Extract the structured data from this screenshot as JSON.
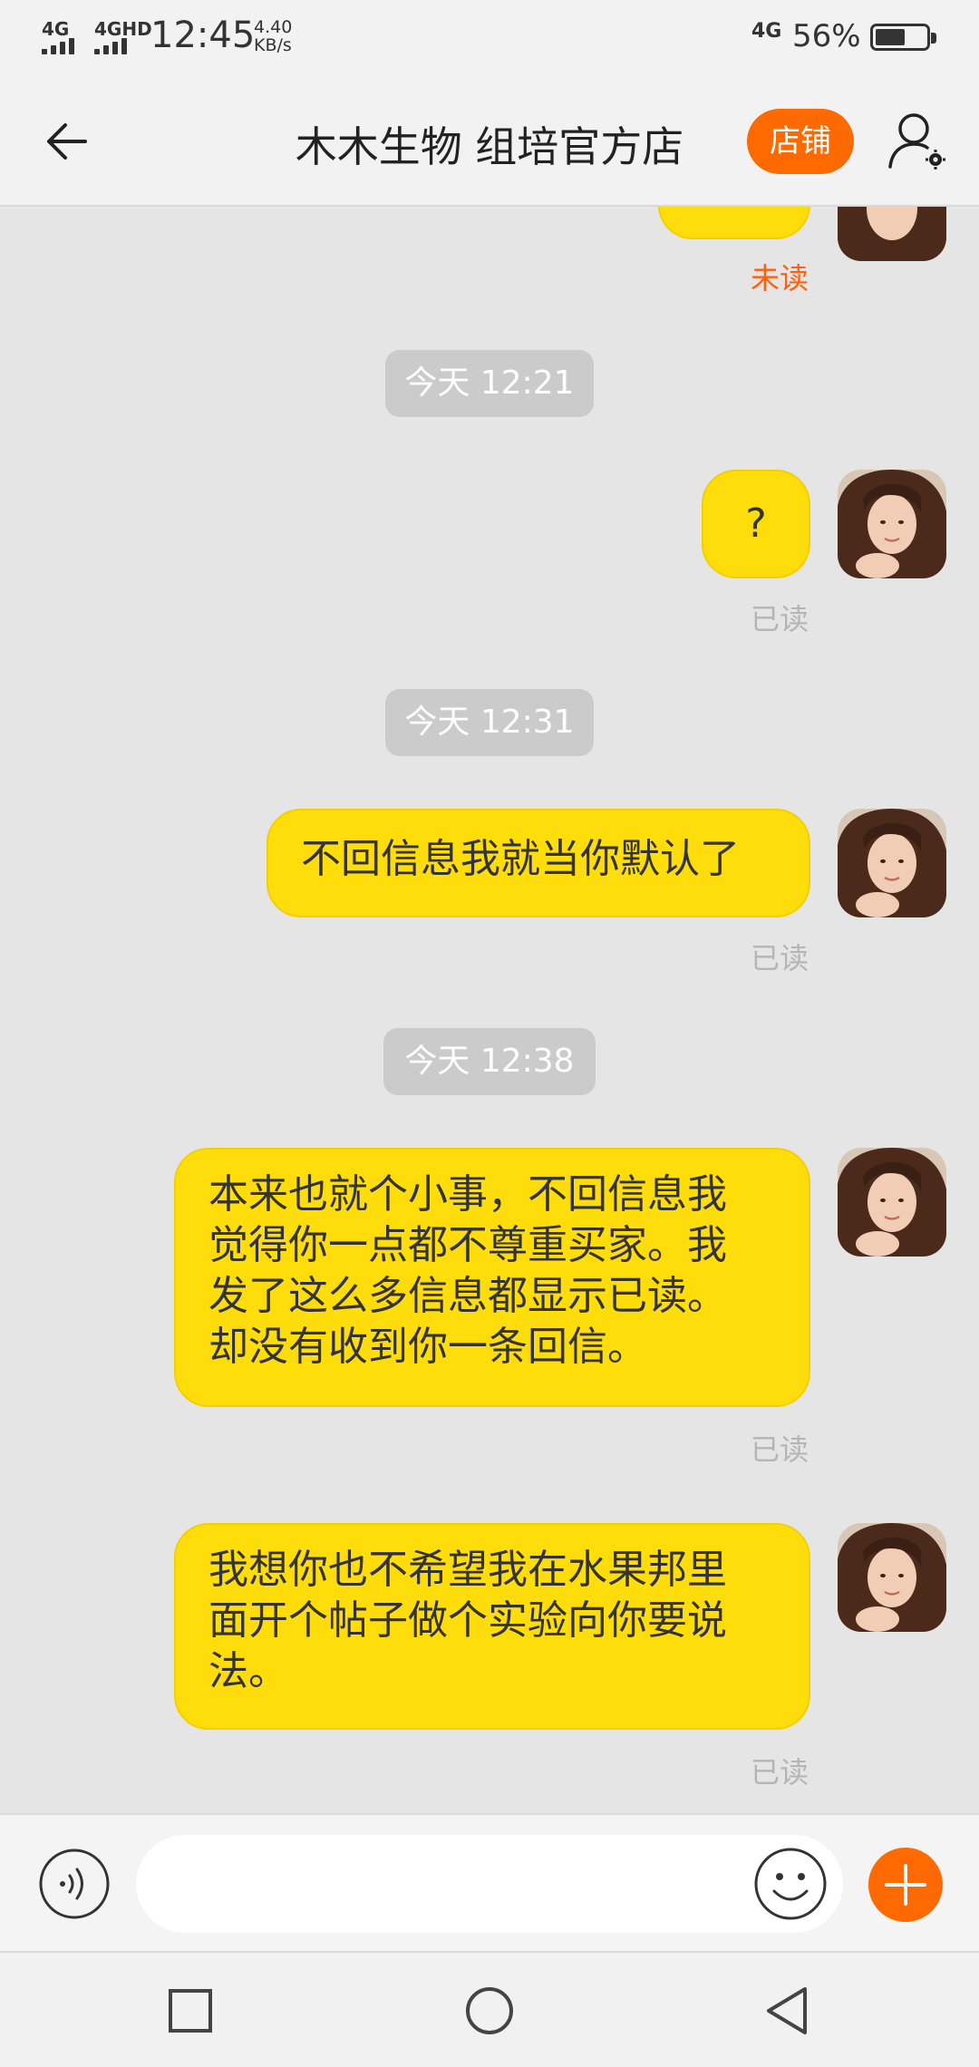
{
  "status_bar": {
    "signal1": "4G",
    "signal2": "4GHD",
    "time": "12:45",
    "speed_value": "4.40",
    "speed_unit": "KB/s",
    "network": "4G",
    "battery": "56%"
  },
  "header": {
    "title": "木木生物 组培官方店",
    "shop_label": "店铺"
  },
  "messages": {
    "m0_status": "未读",
    "ts1": "今天  12:21",
    "m1_text": "?",
    "m1_status": "已读",
    "ts2": "今天  12:31",
    "m2_text": "不回信息我就当你默认了",
    "m2_status": "已读",
    "ts3": "今天  12:38",
    "m3_lines": [
      "本来也就个小事，不回信息我",
      "觉得你一点都不尊重买家。我",
      "发了这么多信息都显示已读。",
      "却没有收到你一条回信。"
    ],
    "m3_status": "已读",
    "m4_lines": [
      "我想你也不希望我在水果邦里",
      "面开个帖子做个实验向你要说",
      "法。"
    ],
    "m4_status": "已读"
  },
  "input": {
    "value": "",
    "placeholder": ""
  },
  "icons": {
    "back": "arrow-left-icon",
    "user_settings": "user-settings-icon",
    "voice": "voice-icon",
    "emoji": "emoji-icon",
    "plus": "plus-icon",
    "nav_recent": "square-icon",
    "nav_home": "circle-icon",
    "nav_back": "triangle-back-icon"
  },
  "colors": {
    "bubble": "#fedd0b",
    "accent": "#ff6a00",
    "unread": "#ff5f0f",
    "read": "#b5b5b5",
    "chat_bg": "#e5e5e5"
  }
}
